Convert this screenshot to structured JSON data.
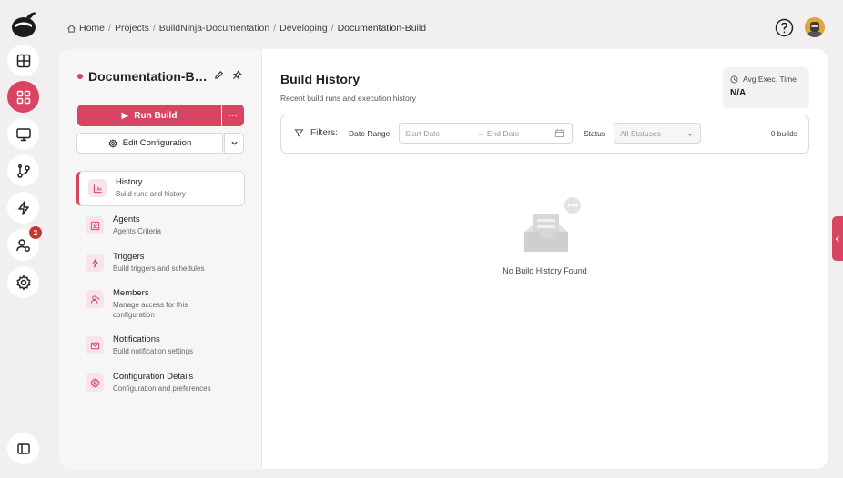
{
  "breadcrumb": {
    "items": [
      "Home",
      "Projects",
      "BuildNinja-Documentation",
      "Developing"
    ],
    "current": "Documentation-Build",
    "separator": "/"
  },
  "rail": {
    "items": [
      {
        "icon": "table-icon"
      },
      {
        "icon": "dashboard-icon"
      },
      {
        "icon": "monitor-icon"
      },
      {
        "icon": "git-branch-icon"
      },
      {
        "icon": "lightning-icon"
      },
      {
        "icon": "user-settings-icon",
        "badge": "2"
      },
      {
        "icon": "gear-icon"
      }
    ],
    "bottom_icon": "sidebar-toggle-icon"
  },
  "sidebar": {
    "title": "Documentation-Build",
    "run_label": "Run Build",
    "more_label": "···",
    "edit_label": "Edit Configuration",
    "nav": [
      {
        "label": "History",
        "desc": "Build runs and history",
        "icon": "chart-icon"
      },
      {
        "label": "Agents",
        "desc": "Agents Criteria",
        "icon": "agent-icon"
      },
      {
        "label": "Triggers",
        "desc": "Build triggers and schedules",
        "icon": "lightning-icon"
      },
      {
        "label": "Members",
        "desc": "Manage access for this configuration",
        "icon": "members-icon"
      },
      {
        "label": "Notifications",
        "desc": "Build notification settings",
        "icon": "mail-icon"
      },
      {
        "label": "Configuration Details",
        "desc": "Configuration and preferences",
        "icon": "gear-icon"
      }
    ]
  },
  "main": {
    "title": "Build History",
    "subtitle": "Recent build runs and execution history",
    "avg_label": "Avg Exec. Time",
    "avg_value": "N/A",
    "filters": {
      "label": "Filters:",
      "date_range_label": "Date Range",
      "start_placeholder": "Start Date",
      "end_placeholder": "→ End Date",
      "status_label": "Status",
      "status_value": "All Statuses",
      "count": "0 builds"
    },
    "empty_text": "No Build History Found"
  },
  "colors": {
    "accent": "#d84563",
    "badge": "#c8352e",
    "background": "#f1eff0"
  }
}
